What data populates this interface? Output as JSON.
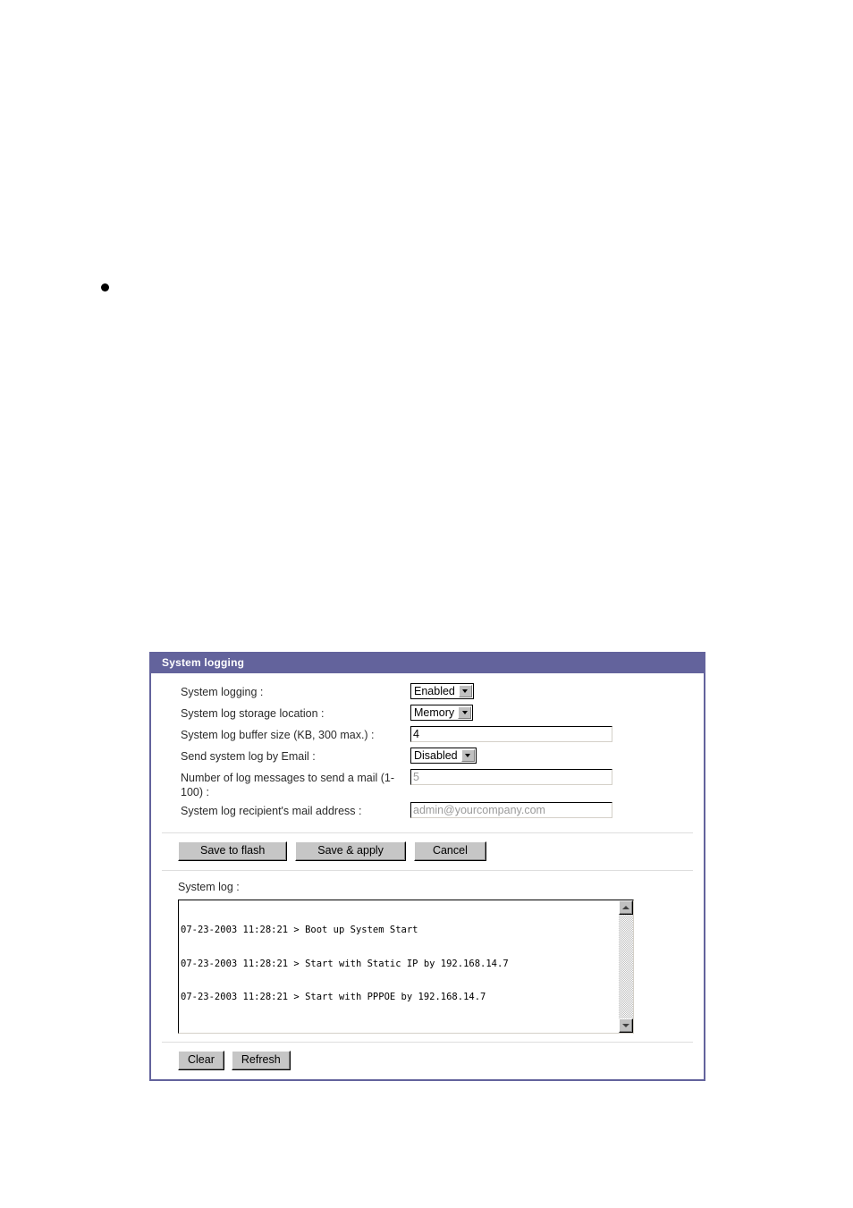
{
  "page": {
    "bullet_marker": "•"
  },
  "panel": {
    "title": "System logging",
    "accent_color": "#63639c",
    "form": {
      "rows": [
        {
          "label": "System logging :",
          "control": "select",
          "value": "Enabled"
        },
        {
          "label": "System log storage location :",
          "control": "select",
          "value": "Memory"
        },
        {
          "label": "System log buffer size (KB, 300 max.) :",
          "control": "input",
          "value": "4"
        },
        {
          "label": "Send system log by Email :",
          "control": "select",
          "value": "Disabled"
        },
        {
          "label": "Number of log messages to send a mail (1-100) :",
          "control": "input",
          "value": "5"
        },
        {
          "label": "System log recipient's mail address :",
          "control": "input",
          "value": "admin@yourcompany.com"
        }
      ]
    },
    "actions": {
      "save_to_flash": "Save to flash",
      "save_and_apply": "Save & apply",
      "cancel": "Cancel"
    },
    "log": {
      "caption": "System log :",
      "lines": [
        "07-23-2003 11:28:21 > Boot up System Start",
        "07-23-2003 11:28:21 > Start with Static IP by 192.168.14.7",
        "07-23-2003 11:28:21 > Start with PPPOE by 192.168.14.7"
      ],
      "scroll_up_icon": "scroll-up-arrow",
      "scroll_down_icon": "scroll-down-arrow"
    },
    "log_actions": {
      "clear": "Clear",
      "refresh": "Refresh"
    }
  }
}
